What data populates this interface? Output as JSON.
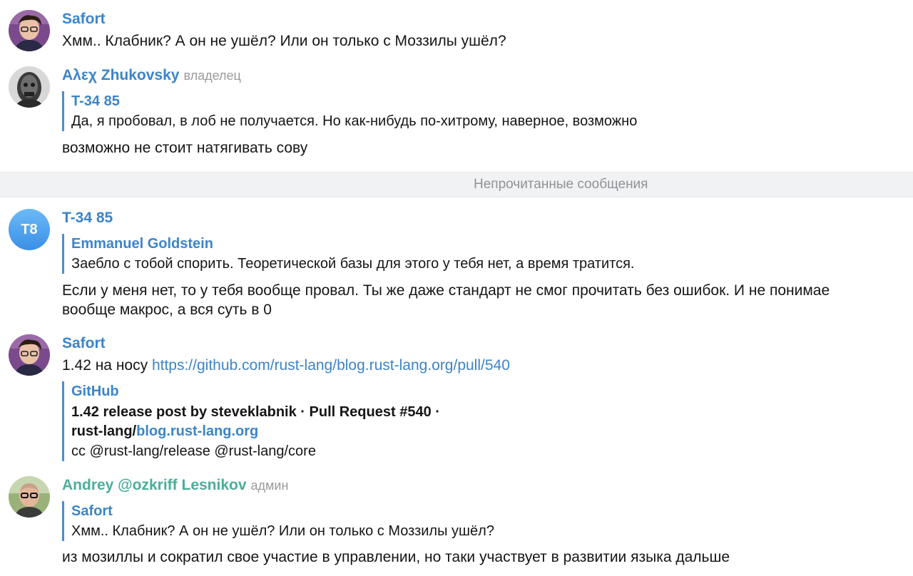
{
  "colors": {
    "name_blue": "#3c84c8",
    "name_teal": "#4aae9b",
    "role_gray": "#9a9a9a",
    "link": "#3c84c8",
    "divider_bg": "#f1f2f4",
    "avatar_t8_top": "#6bbaf8",
    "avatar_t8_bottom": "#3a8fe6"
  },
  "messages": [
    {
      "author": "Safort",
      "avatar_icon": "user-photo-glasses",
      "text": "Хмм.. Клабник? А он не ушёл? Или он только с Моззилы ушёл?"
    },
    {
      "author": "Αλεχ Zhukovsky",
      "role": "владелец",
      "avatar_icon": "user-photo-mask",
      "reply": {
        "author": "T-34 85",
        "text": "Да, я пробовал, в лоб не получается. Но как-нибудь по-хитрому, наверное, возможно"
      },
      "text": "возможно не стоит натягивать сову"
    },
    {
      "author": "T-34 85",
      "avatar_initials": "T8",
      "reply": {
        "author": "Emmanuel Goldstein",
        "text": "Заебло с тобой спорить. Теоретической базы для этого у тебя нет, а время тратится."
      },
      "text_line1": "Если у меня нет, то у тебя вообще провал. Ты же даже стандарт не смог прочитать без ошибок. И не понимае",
      "text_line2": "вообще макрос, а вся суть в 0"
    },
    {
      "author": "Safort",
      "avatar_icon": "user-photo-glasses",
      "text_prefix": "1.42 на носу ",
      "link": "https://github.com/rust-lang/blog.rust-lang.org/pull/540",
      "preview": {
        "site": "GitHub",
        "title_line1": "1.42 release post by steveklabnik · Pull Request #540 ·",
        "title_line2_prefix": "rust-lang/",
        "title_line2_link": "blog.rust-lang.org",
        "description": "cc @rust-lang/release @rust-lang/core"
      }
    },
    {
      "author": "Andrey @ozkriff Lesnikov",
      "role": "админ",
      "avatar_icon": "user-photo-bald-glasses",
      "reply": {
        "author": "Safort",
        "text": "Хмм.. Клабник? А он не ушёл? Или он только с Моззилы ушёл?"
      },
      "text": "из мозиллы и сократил свое участие в управлении, но таки участвует в развитии языка дальше"
    }
  ],
  "unread_divider": "Непрочитанные сообщения"
}
